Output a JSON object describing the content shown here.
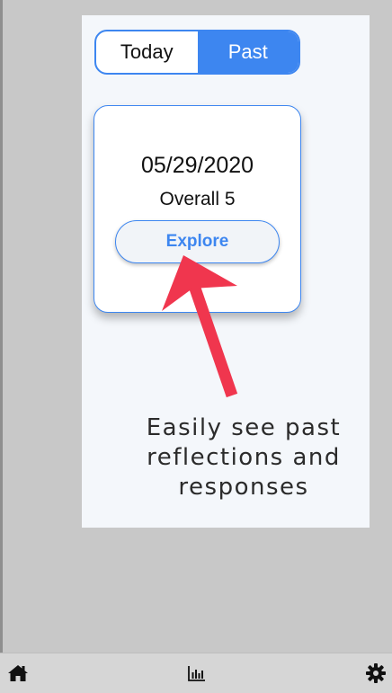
{
  "toggle": {
    "today_label": "Today",
    "past_label": "Past",
    "selected": "Past"
  },
  "card": {
    "date": "05/29/2020",
    "overall": "Overall 5",
    "explore_label": "Explore"
  },
  "annotation": {
    "line1": "Easily see past",
    "line2": "reflections and",
    "line3": "responses"
  },
  "bottom_nav": {
    "items": [
      {
        "icon": "home-icon"
      },
      {
        "icon": "bar-chart-icon"
      },
      {
        "icon": "gear-icon"
      }
    ]
  },
  "colors": {
    "accent": "#3d86f0",
    "arrow": "#f0364e",
    "background": "#c8c8c8",
    "panel": "#f4f7fb"
  }
}
